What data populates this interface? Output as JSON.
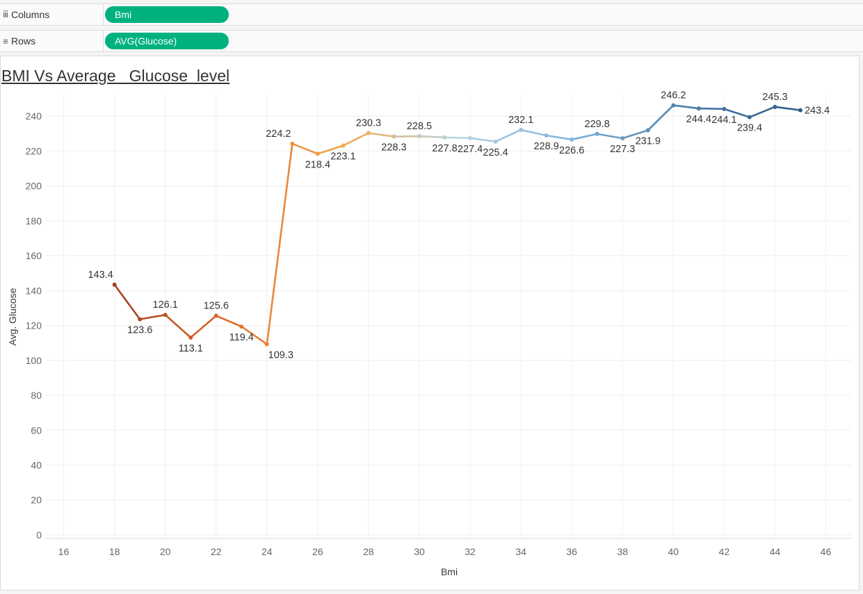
{
  "shelves": {
    "columns": {
      "icon": "columns-icon",
      "label": "Columns",
      "pill": "Bmi"
    },
    "rows": {
      "icon": "rows-icon",
      "label": "Rows",
      "pill": "AVG(Glucose)"
    }
  },
  "pill_color": "#00b180",
  "title": "BMI Vs Average   Glucose  level",
  "chart_data": {
    "type": "line",
    "title": "BMI Vs Average   Glucose  level",
    "xlabel": "Bmi",
    "ylabel": "Avg. Glucose",
    "xlim": [
      15.3,
      47
    ],
    "ylim": [
      -2,
      252
    ],
    "xticks": [
      16,
      18,
      20,
      22,
      24,
      26,
      28,
      30,
      32,
      34,
      36,
      38,
      40,
      42,
      44,
      46
    ],
    "yticks": [
      0,
      20,
      40,
      60,
      80,
      100,
      120,
      140,
      160,
      180,
      200,
      220,
      240
    ],
    "grid": true,
    "legend": "none",
    "color_scale": [
      "#a23f1c",
      "#e06d2a",
      "#f5a84c",
      "#b8d3e4",
      "#7fb3d9",
      "#4a7eac",
      "#2e5a86"
    ],
    "series": [
      {
        "x": [
          18,
          19,
          20,
          21,
          22,
          23,
          24,
          25,
          26,
          27,
          28,
          29,
          30,
          31,
          32,
          33,
          34,
          35,
          36,
          37,
          38,
          39,
          40,
          41,
          42,
          43,
          44,
          45
        ],
        "values": [
          143.4,
          123.6,
          126.1,
          113.1,
          125.6,
          119.4,
          109.3,
          224.2,
          218.4,
          223.1,
          230.3,
          228.3,
          228.5,
          227.8,
          227.4,
          225.4,
          232.1,
          228.9,
          226.6,
          229.8,
          227.3,
          231.9,
          246.2,
          244.4,
          244.1,
          239.4,
          245.3,
          243.4
        ],
        "labels": [
          "143.4",
          "123.6",
          "126.1",
          "113.1",
          "125.6",
          "119.4",
          "109.3",
          "224.2",
          "218.4",
          "223.1",
          "230.3",
          "228.3",
          "228.5",
          "227.8",
          "227.4",
          "225.4",
          "232.1",
          "228.9",
          "226.6",
          "229.8",
          "227.3",
          "231.9",
          "246.2",
          "244.4",
          "244.1",
          "239.4",
          "245.3",
          "243.4"
        ]
      }
    ]
  }
}
